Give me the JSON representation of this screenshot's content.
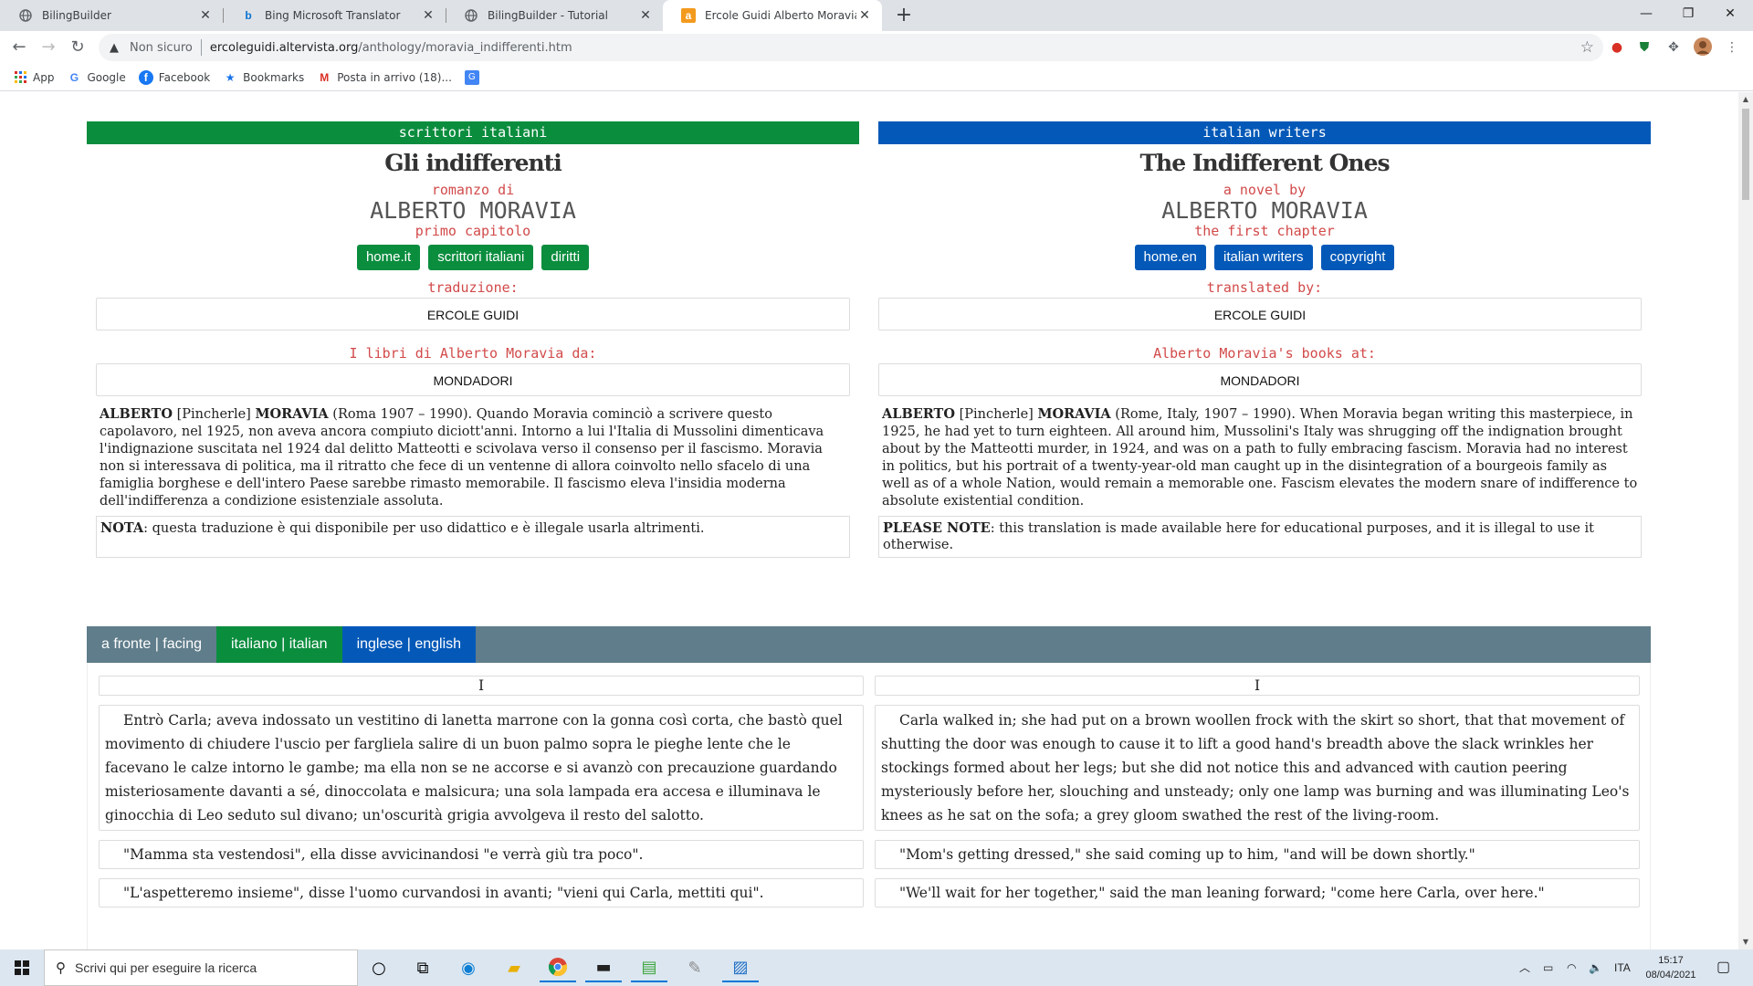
{
  "browser": {
    "tabs": [
      {
        "title": "BilingBuilder",
        "icon": "globe-icon",
        "active": false
      },
      {
        "title": "Bing Microsoft Translator",
        "icon": "bing-icon",
        "active": false
      },
      {
        "title": "BilingBuilder - Tutorial",
        "icon": "globe-icon",
        "active": false
      },
      {
        "title": "Ercole Guidi Alberto Moravia - Gl",
        "icon": "altervista-icon",
        "active": true
      }
    ],
    "address": {
      "security_label": "Non sicuro",
      "url_host": "ercoleguidi.altervista.org",
      "url_path": "/anthology/moravia_indifferenti.htm"
    },
    "bookmarks": [
      {
        "label": "App",
        "icon": "apps-grid-icon"
      },
      {
        "label": "Google",
        "icon": "google-icon"
      },
      {
        "label": "Facebook",
        "icon": "facebook-icon"
      },
      {
        "label": "Bookmarks",
        "icon": "star-icon"
      },
      {
        "label": "Posta in arrivo (18)...",
        "icon": "gmail-icon"
      },
      {
        "label": "",
        "icon": "translate-icon"
      }
    ]
  },
  "page": {
    "left": {
      "band": "scrittori italiani",
      "title": "Gli indifferenti",
      "sub1": "romanzo di",
      "author": "ALBERTO MORAVIA",
      "sub2": "primo capitolo",
      "buttons": [
        "home.it",
        "scrittori italiani",
        "diritti"
      ],
      "translator_label": "traduzione:",
      "translator": "ERCOLE GUIDI",
      "books_label": "I libri di Alberto Moravia da:",
      "publisher": "MONDADORI",
      "bio_name1": "ALBERTO",
      "bio_mid": " [Pincherle] ",
      "bio_name2": "MORAVIA",
      "bio_text": " (Roma 1907 – 1990). Quando Moravia cominciò a scrivere questo capolavoro, nel 1925, non aveva ancora compiuto diciott'anni. Intorno a lui l'Italia di Mussolini dimenticava l'indignazione suscitata nel 1924 dal delitto Matteotti e scivolava verso il consenso per il fascismo. Moravia non si interessava di politica, ma il ritratto che fece di un ventenne di allora coinvolto nello sfacelo di una famiglia borghese e dell'intero Paese sarebbe rimasto memorabile. Il fascismo eleva l'insidia moderna dell'indifferenza a condizione esistenziale assoluta.",
      "note_label": "NOTA",
      "note_text": ": questa traduzione è qui disponibile per uso didattico e è illegale usarla altrimenti."
    },
    "right": {
      "band": "italian writers",
      "title": "The Indifferent Ones",
      "sub1": "a novel by",
      "author": "ALBERTO MORAVIA",
      "sub2": "the first chapter",
      "buttons": [
        "home.en",
        "italian writers",
        "copyright"
      ],
      "translator_label": "translated by:",
      "translator": "ERCOLE GUIDI",
      "books_label": "Alberto Moravia's books at:",
      "publisher": "MONDADORI",
      "bio_name1": "ALBERTO",
      "bio_mid": " [Pincherle] ",
      "bio_name2": "MORAVIA",
      "bio_text": " (Rome, Italy, 1907 – 1990). When Moravia began writing this masterpiece, in 1925, he had yet to turn eighteen. All around him, Mussolini's Italy was shrugging off the indignation brought about by the Matteotti murder, in 1924, and was on a path to fully embracing fascism. Moravia had no interest in politics, but his portrait of a twenty-year-old man caught up in the disintegration of a bourgeois family as well as of a whole Nation, would remain a memorable one. Fascism elevates the modern snare of indifference to absolute existential condition.",
      "note_label": "PLEASE NOTE",
      "note_text": ": this translation is made available here for educational purposes, and it is illegal to use it otherwise."
    },
    "modes": [
      "a fronte | facing",
      "italiano | italian",
      "inglese | english"
    ],
    "chapter": "I",
    "paragraphs_it": [
      "Entrò Carla; aveva indossato un vestitino di lanetta marrone con la gonna così corta, che bastò quel movimento di chiudere l'uscio per fargliela salire di un buon palmo sopra le pieghe lente che le facevano le calze intorno le gambe; ma ella non se ne accorse e si avanzò con precauzione guardando misteriosamente davanti a sé, dinoccolata e malsicura; una sola lampada era accesa e illuminava le ginocchia di Leo seduto sul divano; un'oscurità grigia avvolgeva il resto del salotto.",
      "\"Mamma sta vestendosi\", ella disse avvicinandosi \"e verrà giù tra poco\".",
      "\"L'aspetteremo insieme\", disse l'uomo curvandosi in avanti; \"vieni qui Carla, mettiti qui\"."
    ],
    "paragraphs_en": [
      "Carla walked in; she had put on a brown woollen frock with the skirt so short, that that movement of shutting the door was enough to cause it to lift a good hand's breadth above the slack wrinkles her stockings formed about her legs; but she did not notice this and advanced with caution peering mysteriously before her, slouching and unsteady; only one lamp was burning and was illuminating Leo's knees as he sat on the sofa; a grey gloom swathed the rest of the living-room.",
      "\"Mom's getting dressed,\" she said coming up to him, \"and will be down shortly.\"",
      "\"We'll wait for her together,\" said the man leaning forward; \"come here Carla, over here.\""
    ]
  },
  "taskbar": {
    "search_placeholder": "Scrivi qui per eseguire la ricerca",
    "language": "ITA",
    "time": "15:17",
    "date": "08/04/2021"
  },
  "colors": {
    "green": "#0b8d3e",
    "blue": "#0459b8",
    "red_label": "#d24a4a",
    "mode_bar": "#607d8b"
  }
}
